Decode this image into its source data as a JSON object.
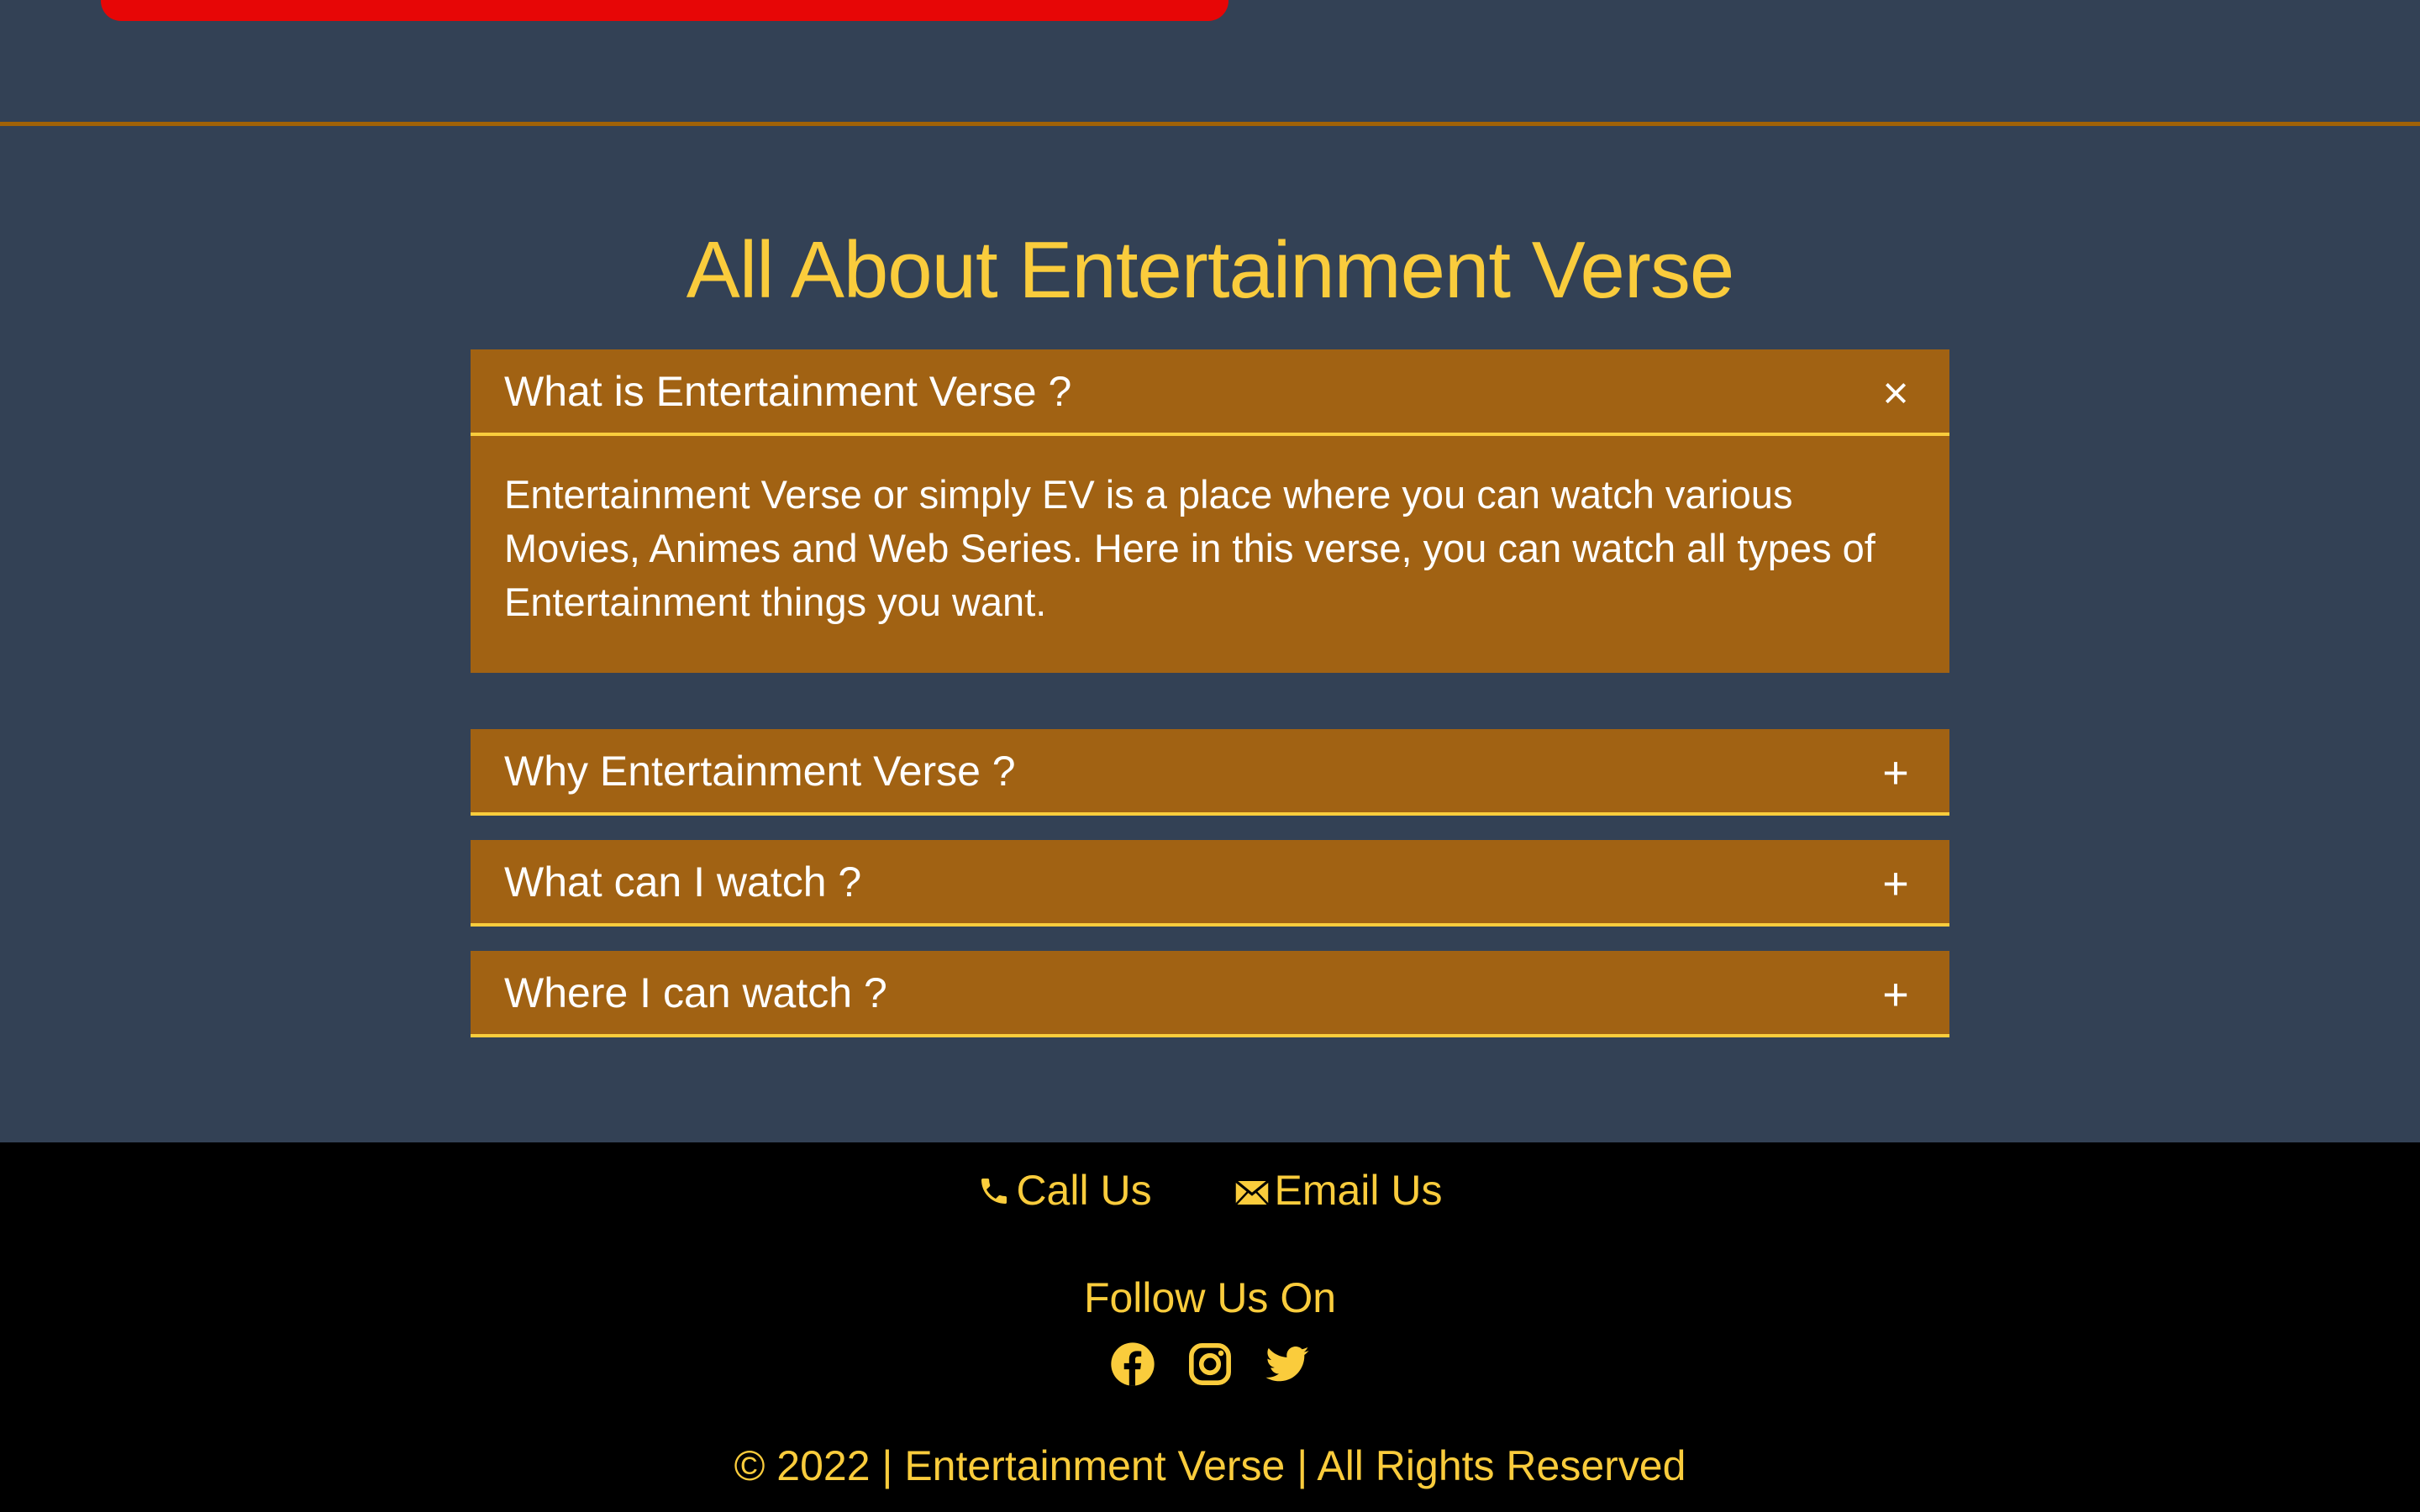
{
  "faq_section": {
    "title": "All About Entertainment Verse",
    "items": [
      {
        "question": "What is Entertainment Verse ?",
        "toggle": "×",
        "expanded": true,
        "answer": "Entertainment Verse or simply EV is a place where you can watch various Movies, Animes and Web Series. Here in this verse, you can watch all types of Entertainment things you want."
      },
      {
        "question": "Why Entertainment Verse ?",
        "toggle": "+",
        "expanded": false
      },
      {
        "question": "What can I watch ?",
        "toggle": "+",
        "expanded": false
      },
      {
        "question": "Where I can watch ?",
        "toggle": "+",
        "expanded": false
      }
    ]
  },
  "footer": {
    "call_label": "Call Us",
    "email_label": "Email Us",
    "follow_title": "Follow Us On",
    "social_icons": [
      "facebook-icon",
      "instagram-icon",
      "twitter-icon"
    ],
    "copyright": "© 2022 | Entertainment Verse | All Rights Reserved"
  },
  "colors": {
    "page_background": "#334155",
    "accent_yellow": "#facc3c",
    "faq_background": "#a16213",
    "divider_orange": "#a16207",
    "banner_red": "#e70606",
    "footer_background": "#000000"
  }
}
